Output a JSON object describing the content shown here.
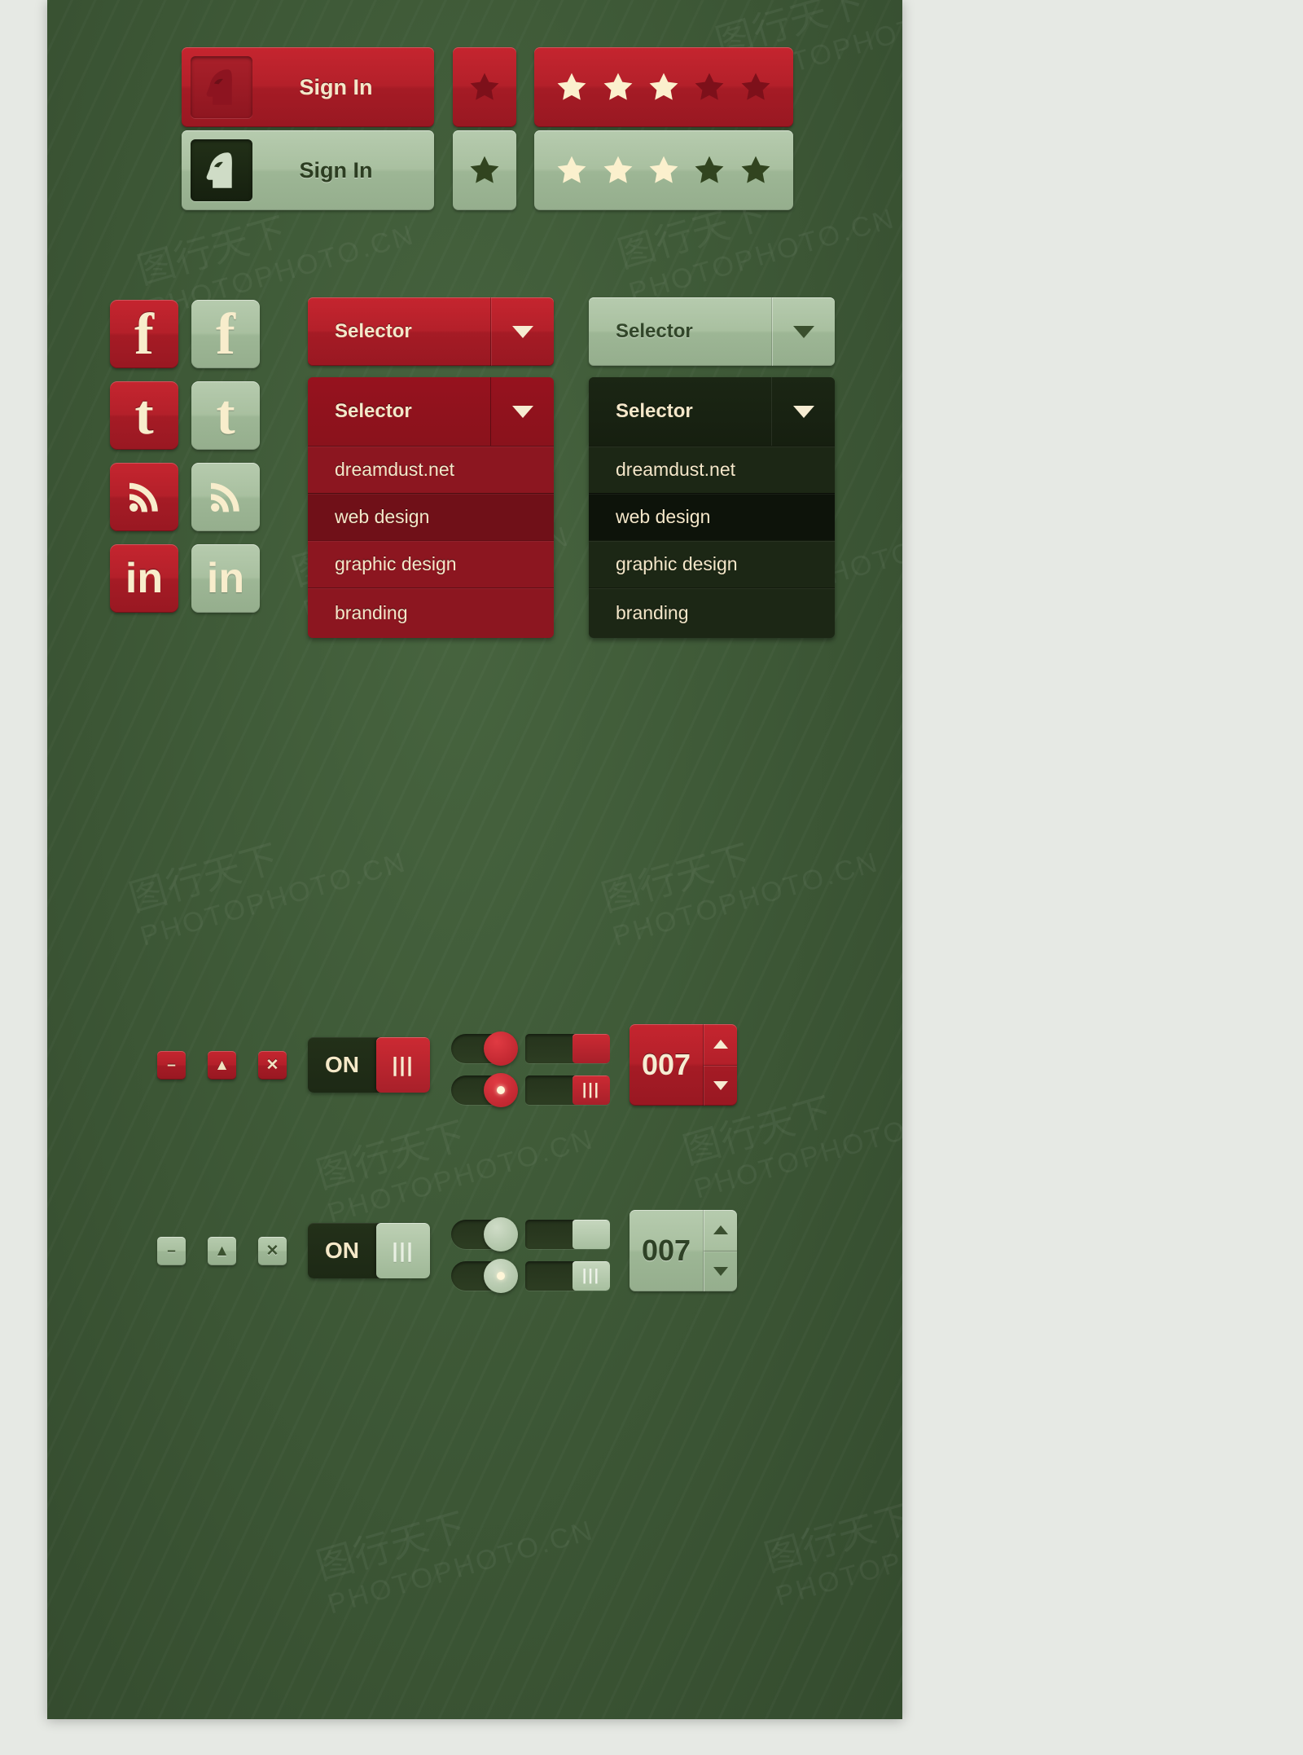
{
  "kit": {
    "background_color": "#3e5937",
    "accent_red": "#b4202a",
    "accent_green": "#a9c0a0",
    "cream": "#f6ecd2",
    "dark_panel": "#1d2915"
  },
  "watermarks": [
    {
      "text": "图行天下",
      "sub": "PHOTOPHOTO.CN"
    },
    {
      "text": "图行天下",
      "sub": "PHOTOPHOTO.CN"
    }
  ],
  "signin": {
    "red": {
      "label": "Sign In",
      "avatar_icon": "knight-chess-horse-icon"
    },
    "green": {
      "label": "Sign In",
      "avatar_icon": "knight-chess-horse-icon"
    }
  },
  "star_button": {
    "red": {
      "icon": "star-icon",
      "state": "dim"
    },
    "green": {
      "icon": "star-icon",
      "state": "dim"
    }
  },
  "rating": {
    "red": {
      "icon": "star-icon",
      "total": 5,
      "filled": 3
    },
    "green": {
      "icon": "star-icon",
      "total": 5,
      "filled": 3
    }
  },
  "social": {
    "red": [
      {
        "name": "facebook",
        "glyph": "f",
        "icon": "facebook-icon"
      },
      {
        "name": "twitter",
        "glyph": "t",
        "icon": "twitter-icon"
      },
      {
        "name": "rss",
        "glyph": "",
        "icon": "rss-icon"
      },
      {
        "name": "linkedin",
        "glyph": "in",
        "icon": "linkedin-icon"
      }
    ],
    "green": [
      {
        "name": "facebook",
        "glyph": "f",
        "icon": "facebook-icon"
      },
      {
        "name": "twitter",
        "glyph": "t",
        "icon": "twitter-icon"
      },
      {
        "name": "rss",
        "glyph": "",
        "icon": "rss-icon"
      },
      {
        "name": "linkedin",
        "glyph": "in",
        "icon": "linkedin-icon"
      }
    ]
  },
  "selectors": {
    "red_closed": {
      "label": "Selector",
      "caret": "chevron-down-icon"
    },
    "green_closed": {
      "label": "Selector",
      "caret": "chevron-down-icon"
    },
    "red_open": {
      "label": "Selector",
      "caret": "chevron-down-icon",
      "items": [
        "dreamdust.net",
        "web design",
        "graphic design",
        "branding"
      ],
      "highlighted": "web design"
    },
    "green_open": {
      "label": "Selector",
      "caret": "chevron-down-icon",
      "items": [
        "dreamdust.net",
        "web design",
        "graphic design",
        "branding"
      ],
      "highlighted": "web design"
    }
  },
  "controls": {
    "red": {
      "minus": {
        "glyph": "–",
        "icon": "minus-icon"
      },
      "up": {
        "glyph": "▲",
        "icon": "caret-up-icon"
      },
      "close": {
        "glyph": "✕",
        "icon": "close-icon"
      },
      "toggle": {
        "label": "ON",
        "handle_glyph": "|||",
        "icon": "toggle-on-icon"
      },
      "pill_switch": {
        "state": "on",
        "icon": "pill-toggle-icon"
      },
      "pill_switch_led": {
        "state": "on",
        "icon": "pill-toggle-led-icon"
      },
      "rect_switch": {
        "state": "on",
        "icon": "rect-toggle-icon"
      },
      "rect_switch_bars": {
        "state": "on",
        "handle_glyph": "|||",
        "icon": "rect-toggle-grip-icon"
      },
      "stepper": {
        "value": "007",
        "up_icon": "triangle-up-icon",
        "down_icon": "triangle-down-icon"
      }
    },
    "green": {
      "minus": {
        "glyph": "–",
        "icon": "minus-icon"
      },
      "up": {
        "glyph": "▲",
        "icon": "caret-up-icon"
      },
      "close": {
        "glyph": "✕",
        "icon": "close-icon"
      },
      "toggle": {
        "label": "ON",
        "handle_glyph": "|||",
        "icon": "toggle-on-icon"
      },
      "pill_switch": {
        "state": "on",
        "icon": "pill-toggle-icon"
      },
      "pill_switch_led": {
        "state": "on",
        "icon": "pill-toggle-led-icon"
      },
      "rect_switch": {
        "state": "on",
        "icon": "rect-toggle-icon"
      },
      "rect_switch_bars": {
        "state": "on",
        "handle_glyph": "|||",
        "icon": "rect-toggle-grip-icon"
      },
      "stepper": {
        "value": "007",
        "up_icon": "triangle-up-icon",
        "down_icon": "triangle-down-icon"
      }
    }
  }
}
